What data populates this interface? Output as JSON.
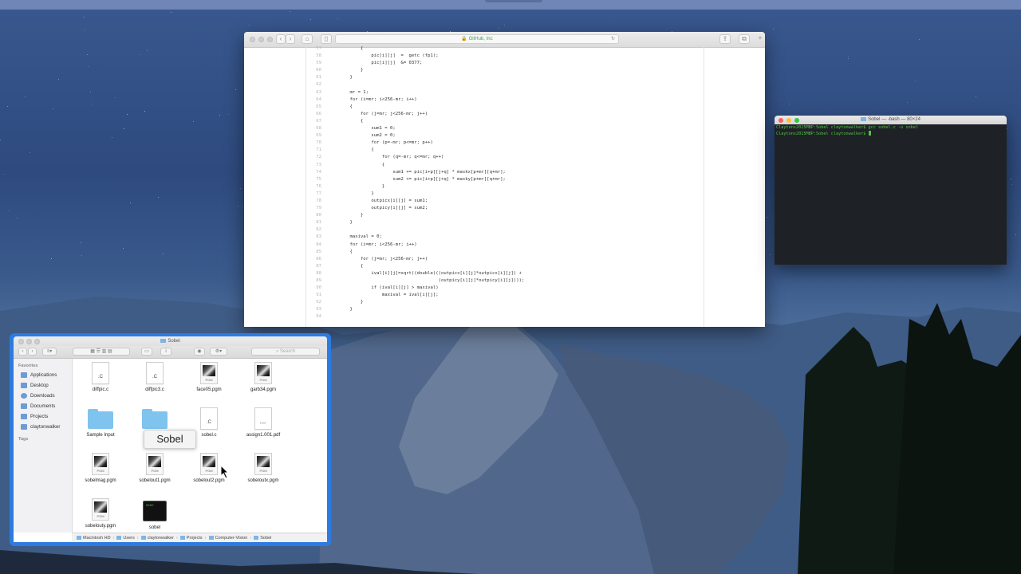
{
  "safari": {
    "url_label": "GitHub, Inc",
    "code": [
      {
        "n": "57",
        "t": "        {"
      },
      {
        "n": "58",
        "t": "            pic[i][j]  =  getc (fp1);"
      },
      {
        "n": "59",
        "t": "            pic[i][j]  &= 0377;"
      },
      {
        "n": "60",
        "t": "        }"
      },
      {
        "n": "61",
        "t": "    }"
      },
      {
        "n": "62",
        "t": ""
      },
      {
        "n": "63",
        "t": "    mr = 1;"
      },
      {
        "n": "64",
        "t": "    for (i=mr; i<256-mr; i++)"
      },
      {
        "n": "65",
        "t": "    {"
      },
      {
        "n": "66",
        "t": "        for (j=mr; j<256-mr; j++)"
      },
      {
        "n": "67",
        "t": "        {"
      },
      {
        "n": "68",
        "t": "            sum1 = 0;"
      },
      {
        "n": "69",
        "t": "            sum2 = 0;"
      },
      {
        "n": "70",
        "t": "            for (p=-mr; p<=mr; p++)"
      },
      {
        "n": "71",
        "t": "            {"
      },
      {
        "n": "72",
        "t": "                for (q=-mr; q<=mr; q++)"
      },
      {
        "n": "73",
        "t": "                {"
      },
      {
        "n": "74",
        "t": "                    sum1 += pic[i+p][j+q] * maskx[p+mr][q+mr];"
      },
      {
        "n": "75",
        "t": "                    sum2 += pic[i+p][j+q] * masky[p+mr][q+mr];"
      },
      {
        "n": "76",
        "t": "                }"
      },
      {
        "n": "77",
        "t": "            }"
      },
      {
        "n": "78",
        "t": "            outpicx[i][j] = sum1;"
      },
      {
        "n": "79",
        "t": "            outpicy[i][j] = sum2;"
      },
      {
        "n": "80",
        "t": "        }"
      },
      {
        "n": "81",
        "t": "    }"
      },
      {
        "n": "82",
        "t": ""
      },
      {
        "n": "83",
        "t": "    maxival = 0;"
      },
      {
        "n": "84",
        "t": "    for (i=mr; i<256-mr; i++)"
      },
      {
        "n": "85",
        "t": "    {"
      },
      {
        "n": "86",
        "t": "        for (j=mr; j<256-mr; j++)"
      },
      {
        "n": "87",
        "t": "        {"
      },
      {
        "n": "88",
        "t": "            ival[i][j]=sqrt((double)((outpicx[i][j]*outpicx[i][j]) +"
      },
      {
        "n": "89",
        "t": "                                     (outpicy[i][j]*outpicy[i][j])));"
      },
      {
        "n": "90",
        "t": "            if (ival[i][j] > maxival)"
      },
      {
        "n": "91",
        "t": "                maxival = ival[i][j];"
      },
      {
        "n": "92",
        "t": "        }"
      },
      {
        "n": "93",
        "t": "    }"
      },
      {
        "n": "94",
        "t": ""
      }
    ]
  },
  "terminal": {
    "title": "Sobel — -bash — 80×24",
    "lines": [
      "Claytons2015MBP:Sobel claytonwalker$ gcc sobel.c -o sobel",
      "Claytons2015MBP:Sobel claytonwalker$ "
    ]
  },
  "finder": {
    "title": "Sobel",
    "search_placeholder": "Search",
    "sidebar_header": "Favorites",
    "tags_header": "Tags",
    "sidebar_items": [
      "Applications",
      "Desktop",
      "Downloads",
      "Documents",
      "Projects",
      "claytonwalker"
    ],
    "files": [
      {
        "name": "diffpic.c",
        "kind": "c",
        "ext": ".C"
      },
      {
        "name": "diffpic3.c",
        "kind": "c",
        "ext": ".C"
      },
      {
        "name": "face05.pgm",
        "kind": "pgm",
        "ext": "PGM"
      },
      {
        "name": "garb34.pgm",
        "kind": "pgm",
        "ext": "PGM"
      },
      {
        "name": "Sample Input",
        "kind": "folder",
        "ext": ""
      },
      {
        "name": "Sa",
        "kind": "folder",
        "ext": ""
      },
      {
        "name": "sobel.c",
        "kind": "c",
        "ext": ".C"
      },
      {
        "name": "assign1.001.pdf",
        "kind": "pdf",
        "ext": "PDF"
      },
      {
        "name": "sobelmag.pgm",
        "kind": "pgm",
        "ext": "PGM"
      },
      {
        "name": "sobelout1.pgm",
        "kind": "pgm",
        "ext": "PGM"
      },
      {
        "name": "sobelout2.pgm",
        "kind": "pgm",
        "ext": "PGM"
      },
      {
        "name": "sobeloutx.pgm",
        "kind": "pgm",
        "ext": "PGM"
      },
      {
        "name": "sobelouty.pgm",
        "kind": "pgm",
        "ext": "PGM"
      },
      {
        "name": "sobel",
        "kind": "exec",
        "ext": "exec"
      }
    ],
    "tooltip": "Sobel",
    "path": [
      "Macintosh HD",
      "Users",
      "claytonwalker",
      "Projects",
      "Computer-Vision",
      "Sobel"
    ]
  },
  "colors": {
    "finder_accent": "#2d7be0",
    "terminal_green": "#52c244",
    "safari_secure": "#3aa24a"
  }
}
